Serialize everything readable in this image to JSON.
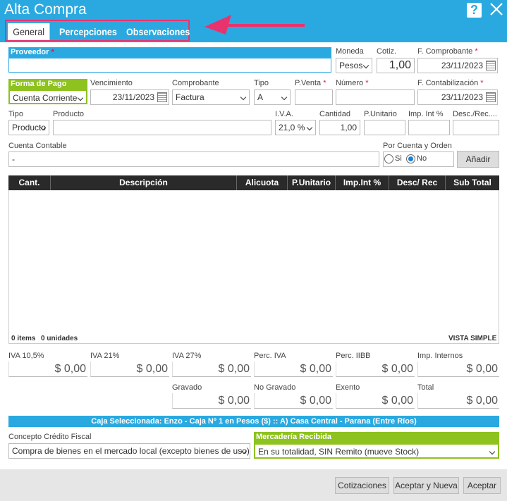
{
  "window": {
    "title": "Alta Compra",
    "help_icon": "?",
    "close_icon": "close-icon"
  },
  "tabs": [
    {
      "label": "General",
      "active": true
    },
    {
      "label": "Percepciones",
      "active": false
    },
    {
      "label": "Observaciones",
      "active": false
    }
  ],
  "form": {
    "proveedor": {
      "label": "Proveedor",
      "value": ""
    },
    "moneda": {
      "label": "Moneda",
      "value": "Pesos"
    },
    "cotiz": {
      "label": "Cotiz.",
      "value": "1,00"
    },
    "f_comprobante": {
      "label": "F. Comprobante",
      "value": "23/11/2023"
    },
    "forma_pago": {
      "label": "Forma de Pago",
      "value": "Cuenta Corriente"
    },
    "vencimiento": {
      "label": "Vencimiento",
      "value": "23/11/2023"
    },
    "comprobante": {
      "label": "Comprobante",
      "value": "Factura"
    },
    "tipo_comp": {
      "label": "Tipo",
      "value": "A"
    },
    "p_venta": {
      "label": "P.Venta",
      "value": ""
    },
    "numero": {
      "label": "Número",
      "value": ""
    },
    "f_contabilizacion": {
      "label": "F. Contabilización",
      "value": "23/11/2023"
    },
    "tipo_item": {
      "label": "Tipo",
      "value": "Producto"
    },
    "producto": {
      "label": "Producto",
      "value": ""
    },
    "iva": {
      "label": "I.V.A.",
      "value": "21,0 %"
    },
    "cantidad": {
      "label": "Cantidad",
      "value": "1,00"
    },
    "p_unitario": {
      "label": "P.Unitario",
      "value": ""
    },
    "imp_int": {
      "label": "Imp. Int %",
      "value": ""
    },
    "desc_rec": {
      "label": "Desc./Rec....",
      "value": ""
    },
    "cuenta_contable": {
      "label": "Cuenta Contable",
      "value": "-"
    },
    "por_cuenta": {
      "label": "Por Cuenta y Orden",
      "si": "Si",
      "no": "No",
      "selected": "No"
    },
    "add_button": "Añadir"
  },
  "grid": {
    "columns": [
      "Cant.",
      "Descripción",
      "Alicuota",
      "P.Unitario",
      "Imp.Int %",
      "Desc/ Rec",
      "Sub Total"
    ],
    "footer_items": "0 items",
    "footer_units": "0 unidades",
    "view_mode": "VISTA SIMPLE"
  },
  "totals": {
    "iva105": {
      "label": "IVA 10,5%",
      "value": "$ 0,00"
    },
    "iva21": {
      "label": "IVA 21%",
      "value": "$ 0,00"
    },
    "iva27": {
      "label": "IVA 27%",
      "value": "$ 0,00"
    },
    "perc_iva": {
      "label": "Perc. IVA",
      "value": "$ 0,00"
    },
    "perc_iibb": {
      "label": "Perc. IIBB",
      "value": "$ 0,00"
    },
    "imp_internos": {
      "label": "Imp. Internos",
      "value": "$ 0,00"
    },
    "gravado": {
      "label": "Gravado",
      "value": "$ 0,00"
    },
    "no_gravado": {
      "label": "No Gravado",
      "value": "$ 0,00"
    },
    "exento": {
      "label": "Exento",
      "value": "$ 0,00"
    },
    "total": {
      "label": "Total",
      "value": "$ 0,00"
    }
  },
  "caja": "Caja Seleccionada: Enzo - Caja Nº 1 en Pesos ($) :: A) Casa Central - Parana (Entre Ríos)",
  "concepto": {
    "label": "Concepto Crédito Fiscal",
    "value": "Compra de bienes en el mercado local (excepto bienes de uso)"
  },
  "mercaderia": {
    "label": "Mercadería Recibida",
    "value": "En su totalidad, SIN Remito (mueve Stock)"
  },
  "buttons": {
    "cotizaciones": "Cotizaciones",
    "aceptar_nueva": "Aceptar y Nueva",
    "aceptar": "Aceptar"
  },
  "colors": {
    "accent": "#2aa9e0",
    "green": "#8dc21f",
    "highlight": "#e8336e",
    "header_dark": "#2a2a2a"
  }
}
